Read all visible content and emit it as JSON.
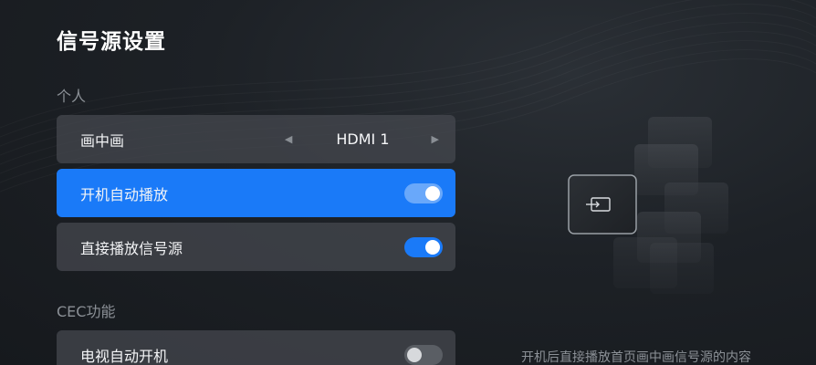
{
  "page": {
    "title": "信号源设置"
  },
  "sections": {
    "personal": {
      "title": "个人"
    },
    "cec": {
      "title": "CEC功能"
    }
  },
  "settings": {
    "pip": {
      "label": "画中画",
      "value": "HDMI 1",
      "left_icon": "triangle-left-icon",
      "right_icon": "triangle-right-icon"
    },
    "auto_play_on_boot": {
      "label": "开机自动播放",
      "enabled": true,
      "focused": true
    },
    "direct_play_source": {
      "label": "直接播放信号源",
      "enabled": true
    },
    "tv_auto_power_on": {
      "label": "电视自动开机",
      "enabled": false
    }
  },
  "preview": {
    "icon": "input-source-icon",
    "caption": "开机后直接播放首页画中画信号源的内容"
  },
  "colors": {
    "accent": "#1a7af8",
    "row_bg": "#464a50",
    "background": "#1d2126"
  }
}
